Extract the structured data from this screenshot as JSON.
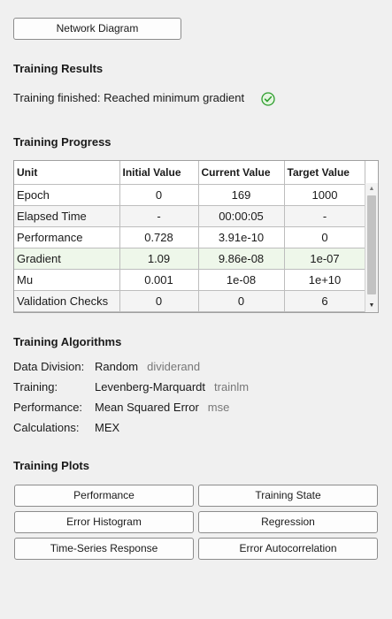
{
  "network_diagram_label": "Network Diagram",
  "results": {
    "title": "Training Results",
    "status": "Training finished: Reached minimum gradient",
    "status_icon": "check-circle-icon",
    "status_color": "#2e9e2e"
  },
  "progress": {
    "title": "Training Progress",
    "columns": [
      "Unit",
      "Initial Value",
      "Current Value",
      "Target Value"
    ],
    "rows": [
      {
        "unit": "Epoch",
        "initial": "0",
        "current": "169",
        "target": "1000"
      },
      {
        "unit": "Elapsed Time",
        "initial": "-",
        "current": "00:00:05",
        "target": "-"
      },
      {
        "unit": "Performance",
        "initial": "0.728",
        "current": "3.91e-10",
        "target": "0"
      },
      {
        "unit": "Gradient",
        "initial": "1.09",
        "current": "9.86e-08",
        "target": "1e-07"
      },
      {
        "unit": "Mu",
        "initial": "0.001",
        "current": "1e-08",
        "target": "1e+10"
      },
      {
        "unit": "Validation Checks",
        "initial": "0",
        "current": "0",
        "target": "6"
      }
    ],
    "highlight_color": "#eef7ea"
  },
  "algorithms": {
    "title": "Training Algorithms",
    "rows": [
      {
        "label": "Data Division:",
        "value": "Random",
        "fn": "dividerand"
      },
      {
        "label": "Training:",
        "value": "Levenberg-Marquardt",
        "fn": "trainlm"
      },
      {
        "label": "Performance:",
        "value": "Mean Squared Error",
        "fn": "mse"
      },
      {
        "label": "Calculations:",
        "value": "MEX",
        "fn": ""
      }
    ]
  },
  "plots": {
    "title": "Training Plots",
    "buttons": [
      "Performance",
      "Training State",
      "Error Histogram",
      "Regression",
      "Time-Series Response",
      "Error Autocorrelation"
    ]
  }
}
